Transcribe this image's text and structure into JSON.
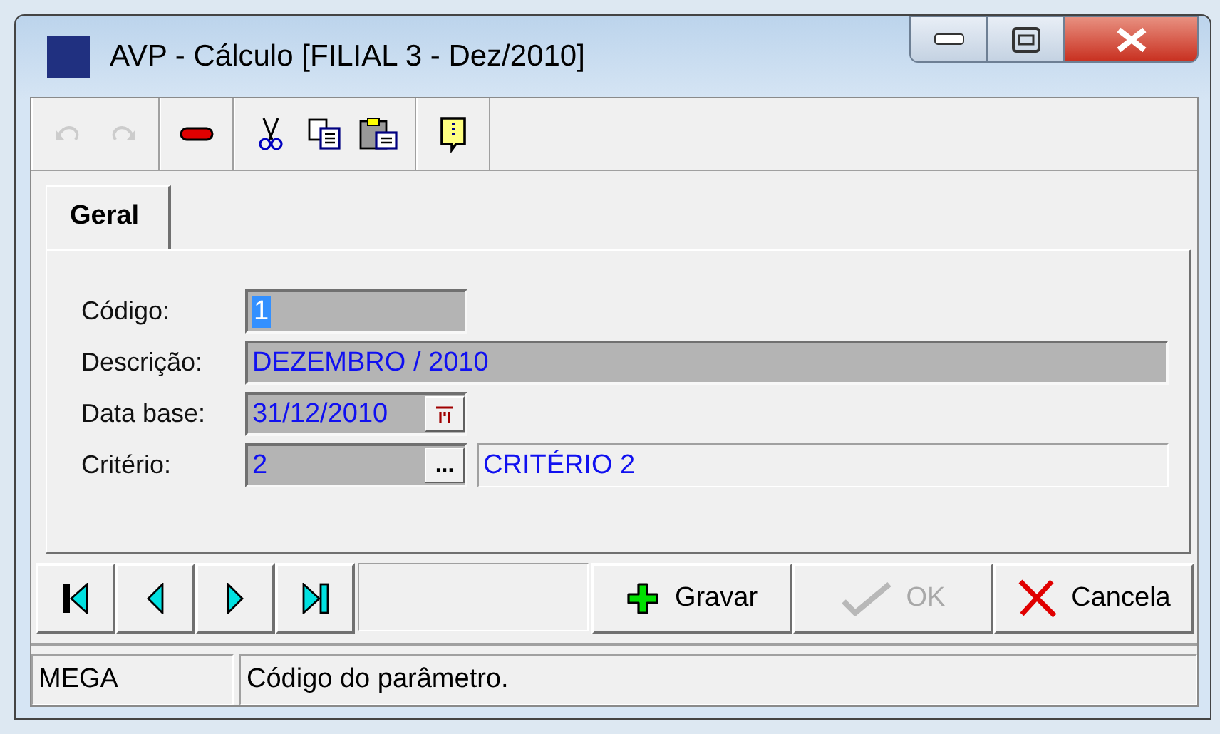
{
  "window": {
    "title": "AVP - Cálculo [FILIAL 3 - Dez/2010]"
  },
  "toolbar": [
    [
      {
        "kind": "undo",
        "disabled": true
      },
      {
        "kind": "redo",
        "disabled": true
      }
    ],
    [
      {
        "kind": "delete",
        "disabled": false
      }
    ],
    [
      {
        "kind": "cut",
        "disabled": false
      },
      {
        "kind": "copy",
        "disabled": false
      },
      {
        "kind": "paste",
        "disabled": false
      }
    ],
    [
      {
        "kind": "info",
        "disabled": false
      }
    ]
  ],
  "tabs": [
    {
      "label": "Geral",
      "selected": true
    }
  ],
  "fields": [
    {
      "kind": "text",
      "label": "Código:",
      "value": "1",
      "focused": true
    },
    {
      "kind": "long_text",
      "label": "Descrição:",
      "value": "DEZEMBRO / 2010",
      "focused": false
    },
    {
      "kind": "date",
      "label": "Data base:",
      "value": "31/12/2010",
      "focused": false
    },
    {
      "kind": "lookup",
      "label": "Critério:",
      "value": "2",
      "button": "...",
      "description": "CRITÉRIO 2",
      "focused": false
    }
  ],
  "navigation": [
    {
      "kind": "first"
    },
    {
      "kind": "previous"
    },
    {
      "kind": "next"
    },
    {
      "kind": "last"
    }
  ],
  "actions": [
    {
      "kind": "save",
      "label": "Gravar",
      "disabled": false
    },
    {
      "kind": "ok",
      "label": "OK",
      "disabled": true
    },
    {
      "kind": "cancel",
      "label": "Cancela",
      "disabled": false
    }
  ],
  "status_bar": [
    "MEGA",
    "Código do parâmetro."
  ]
}
